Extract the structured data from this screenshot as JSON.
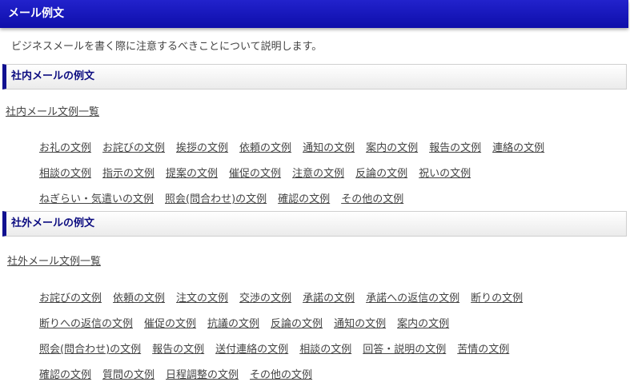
{
  "header": {
    "title": "メール例文"
  },
  "intro": "ビジネスメールを書く際に注意するべきことについて説明します。",
  "internal": {
    "title": "社内メールの例文",
    "overview": "社内メール文例一覧",
    "rows": [
      [
        "お礼の文例",
        "お詫びの文例",
        "挨拶の文例",
        "依頼の文例",
        "通知の文例",
        "案内の文例",
        "報告の文例",
        "連絡の文例"
      ],
      [
        "相談の文例",
        "指示の文例",
        "提案の文例",
        "催促の文例",
        "注意の文例",
        "反論の文例",
        "祝いの文例"
      ],
      [
        "ねぎらい・気遣いの文例",
        "照会(問合わせ)の文例",
        "確認の文例",
        "その他の文例"
      ]
    ]
  },
  "external": {
    "title": "社外メールの例文",
    "overview": "社外メール文例一覧",
    "rows": [
      [
        "お詫びの文例",
        "依頼の文例",
        "注文の文例",
        "交渉の文例",
        "承諾の文例",
        "承諾への返信の文例",
        "断りの文例"
      ],
      [
        "断りへの返信の文例",
        "催促の文例",
        "抗議の文例",
        "反論の文例",
        "通知の文例",
        "案内の文例"
      ],
      [
        "照会(問合わせ)の文例",
        "報告の文例",
        "送付連絡の文例",
        "相談の文例",
        "回答・説明の文例",
        "苦情の文例"
      ],
      [
        "確認の文例",
        "質問の文例",
        "日程調整の文例",
        "その他の文例"
      ]
    ]
  }
}
